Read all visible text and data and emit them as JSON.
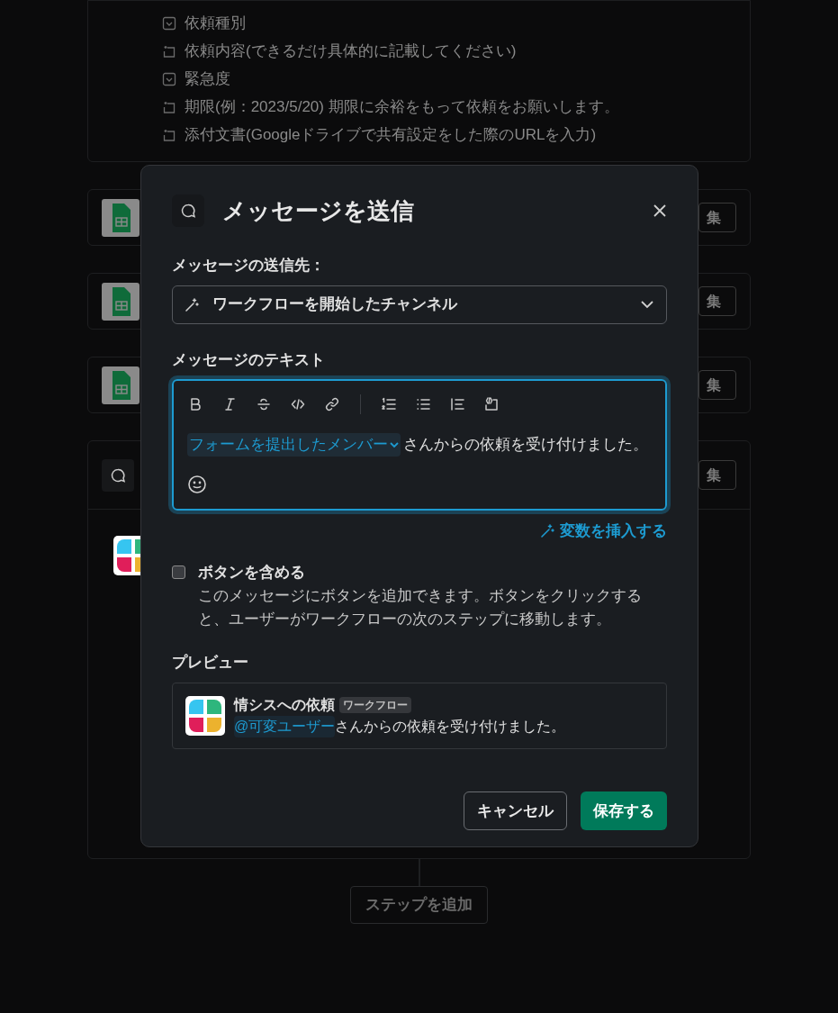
{
  "background": {
    "fields": [
      {
        "kind": "select",
        "label": "依頼種別"
      },
      {
        "kind": "text",
        "label": "依頼内容(できるだけ具体的に記載してください)"
      },
      {
        "kind": "select",
        "label": "緊急度"
      },
      {
        "kind": "text",
        "label": "期限(例：2023/5/20) 期限に余裕をもって依頼をお願いします。"
      },
      {
        "kind": "text",
        "label": "添付文書(Googleドライブで共有設定をした際のURLを入力)"
      }
    ],
    "steps": [
      {
        "kind": "sheet",
        "edit": "集"
      },
      {
        "kind": "sheet",
        "edit": "集"
      },
      {
        "kind": "sheet",
        "edit": "集"
      },
      {
        "kind": "message",
        "edit": "集"
      }
    ],
    "add_step": "ステップを追加"
  },
  "dialog": {
    "title": "メッセージを送信",
    "destination_label": "メッセージの送信先：",
    "destination_value": "ワークフローを開始したチャンネル",
    "text_label": "メッセージのテキスト",
    "variable_chip": "フォームを提出したメンバー",
    "message_text": "さんからの依頼を受け付けました。",
    "insert_variable": "変数を挿入する",
    "include_buttons": {
      "label": "ボタンを含める",
      "description": "このメッセージにボタンを追加できます。ボタンをクリックすると、ユーザーがワークフローの次のステップに移動します。",
      "checked": false
    },
    "preview_label": "プレビュー",
    "preview": {
      "app_name": "情シスへの依頼",
      "badge": "ワークフロー",
      "mention": "@可変ユーザー",
      "text": "さんからの依頼を受け付けました。"
    },
    "buttons": {
      "cancel": "キャンセル",
      "save": "保存する"
    }
  }
}
